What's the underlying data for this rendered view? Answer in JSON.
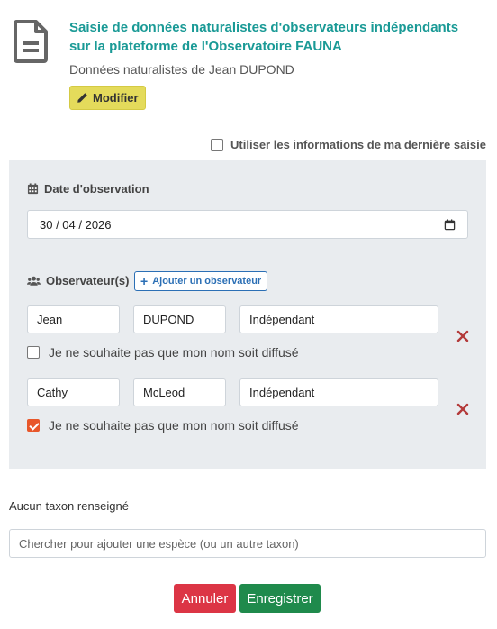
{
  "header": {
    "icon": "document-icon",
    "title": "Saisie de données naturalistes d'observateurs indépendants sur la plateforme de l'Observatoire FAUNA",
    "subtitle": "Données naturalistes de Jean DUPOND",
    "modify_label": "Modifier"
  },
  "use_last": {
    "label": "Utiliser les informations de ma dernière saisie",
    "checked": false
  },
  "date": {
    "label": "Date d'observation",
    "value": "30 / 04 / 2026"
  },
  "observers": {
    "label": "Observateur(s)",
    "add_label": "Ajouter un observateur",
    "items": [
      {
        "first_name": "Jean",
        "last_name": "DUPOND",
        "structure": "Indépendant",
        "anon_label": "Je ne souhaite pas que mon nom soit diffusé",
        "anon_checked": false
      },
      {
        "first_name": "Cathy",
        "last_name": "McLeod",
        "structure": "Indépendant",
        "anon_label": "Je ne souhaite pas que mon nom soit diffusé",
        "anon_checked": true
      }
    ]
  },
  "taxon": {
    "empty_label": "Aucun taxon renseigné",
    "search_placeholder": "Chercher pour ajouter une espèce (ou un autre taxon)"
  },
  "actions": {
    "cancel_label": "Annuler",
    "save_label": "Enregistrer"
  },
  "colors": {
    "accent": "#1a9a96",
    "modify": "#e4db5b",
    "cancel": "#dc3545",
    "save": "#1f8a4c",
    "remove": "#b33a3a",
    "check": "#e8572a"
  }
}
